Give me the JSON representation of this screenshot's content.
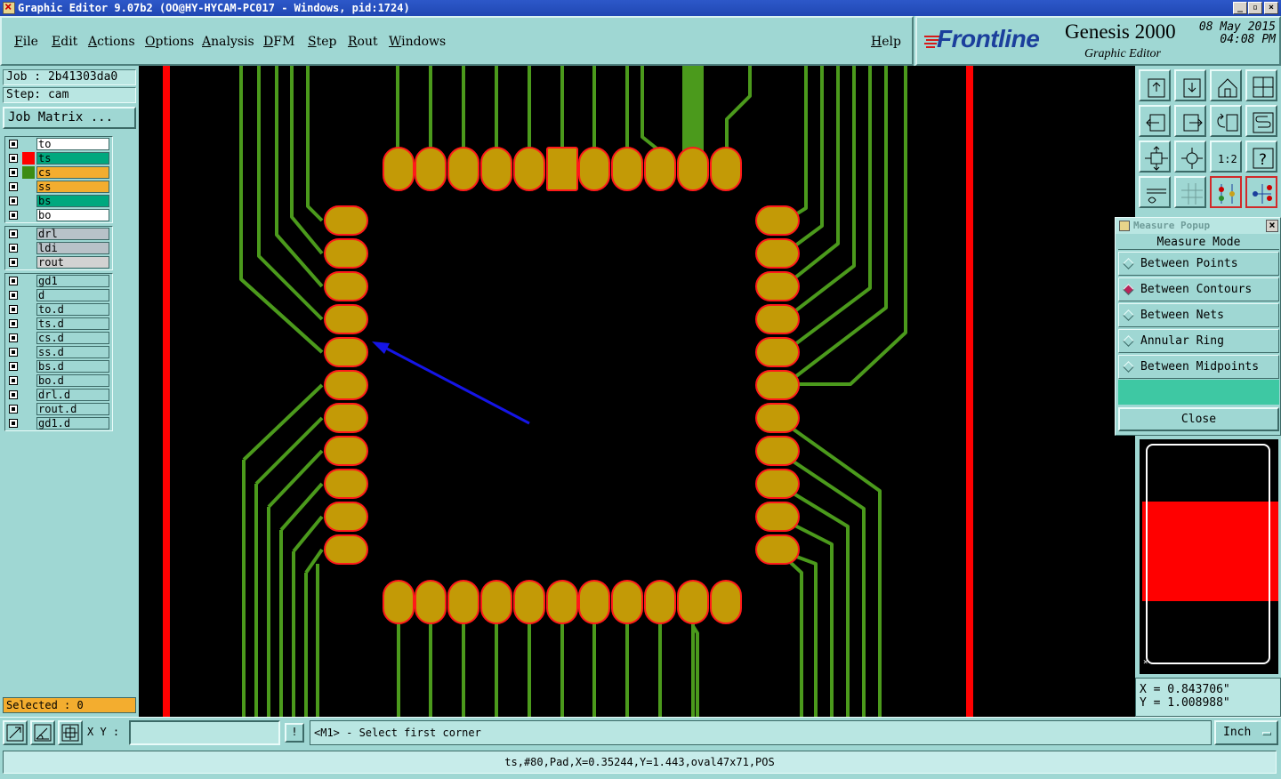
{
  "window": {
    "title": "Graphic Editor 9.07b2 (OO@HY-HYCAM-PC017 - Windows, pid:1724)",
    "controls": [
      "_",
      "▫",
      "×"
    ]
  },
  "menu": {
    "items": [
      "File",
      "Edit",
      "Actions",
      "Options",
      "Analysis",
      "DFM",
      "Step",
      "Rout",
      "Windows"
    ],
    "help": "Help"
  },
  "brand": {
    "logo": "Frontline",
    "product": "Genesis 2000",
    "subtitle": "Graphic Editor",
    "date": "08 May 2015",
    "time": "04:08 PM"
  },
  "job": {
    "job_label": "Job : 2b41303da0",
    "step_label": "Step: cam",
    "matrix_button": "Job Matrix ..."
  },
  "layers": {
    "board": [
      {
        "name": "to",
        "swatch": "",
        "bg": "#ffffff"
      },
      {
        "name": "ts",
        "swatch": "#ff0000",
        "bg": "#00a87e"
      },
      {
        "name": "cs",
        "swatch": "#3c8c14",
        "bg": "#f3ad2f"
      },
      {
        "name": "ss",
        "swatch": "",
        "bg": "#f3ad2f"
      },
      {
        "name": "bs",
        "swatch": "",
        "bg": "#00a87e"
      },
      {
        "name": "bo",
        "swatch": "",
        "bg": "#ffffff"
      }
    ],
    "drill": [
      {
        "name": "drl",
        "swatch": "",
        "bg": "#b8c2c8"
      },
      {
        "name": "ldi",
        "swatch": "",
        "bg": "#b8c2c8"
      },
      {
        "name": "rout",
        "swatch": "",
        "bg": "#d2d2d2"
      }
    ],
    "misc": [
      {
        "name": "gd1",
        "swatch": "",
        "bg": "#9fd7d3"
      },
      {
        "name": "d",
        "swatch": "",
        "bg": "#9fd7d3"
      },
      {
        "name": "to.d",
        "swatch": "",
        "bg": "#9fd7d3"
      },
      {
        "name": "ts.d",
        "swatch": "",
        "bg": "#9fd7d3"
      },
      {
        "name": "cs.d",
        "swatch": "",
        "bg": "#9fd7d3"
      },
      {
        "name": "ss.d",
        "swatch": "",
        "bg": "#9fd7d3"
      },
      {
        "name": "bs.d",
        "swatch": "",
        "bg": "#9fd7d3"
      },
      {
        "name": "bo.d",
        "swatch": "",
        "bg": "#9fd7d3"
      },
      {
        "name": "drl.d",
        "swatch": "",
        "bg": "#9fd7d3"
      },
      {
        "name": "rout.d",
        "swatch": "",
        "bg": "#9fd7d3"
      },
      {
        "name": "gd1.d",
        "swatch": "",
        "bg": "#9fd7d3"
      }
    ]
  },
  "selected": "Selected : 0",
  "measure": {
    "title": "Measure Popup",
    "header": "Measure Mode",
    "options": [
      "Between Points",
      "Between Contours",
      "Between Nets",
      "Annular Ring",
      "Between Midpoints"
    ],
    "active_option": "Between Contours",
    "close": "Close"
  },
  "coords": {
    "x": "X = 0.843706\"",
    "y": "Y = 1.008988\""
  },
  "command": {
    "xy_label": "X Y :",
    "xy_value": "",
    "bang": "!",
    "prompt": "<M1> - Select first corner",
    "units": "Inch"
  },
  "status": "ts,#80,Pad,X=0.35244,Y=1.443,oval47x71,POS",
  "colors": {
    "canvas_bg": "#000000",
    "trace": "#4b9a1c",
    "pad_fill": "#c39a06",
    "pad_outline": "#ff1a1a",
    "board_edge": "#ff0000",
    "arrow": "#1515e6",
    "panel": "#9fd7d3"
  }
}
